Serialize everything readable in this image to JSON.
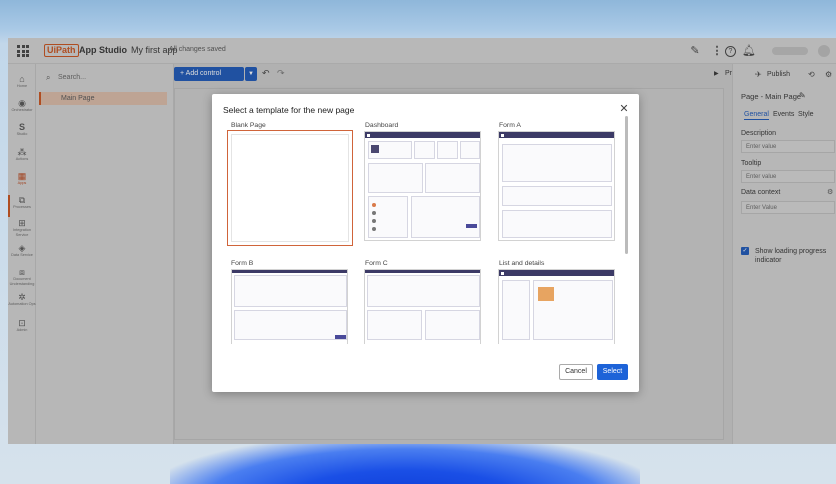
{
  "header": {
    "logo": "UiPath",
    "product": "App Studio",
    "app_name": "My first app",
    "save_status": "All changes saved"
  },
  "left_rail": {
    "items": [
      {
        "icon": "home-icon",
        "label": "Home"
      },
      {
        "icon": "automation-ops-icon",
        "label": "Orchestrator"
      },
      {
        "icon": "studio-icon",
        "label": "Studio"
      },
      {
        "icon": "actions-icon",
        "label": "Actions"
      },
      {
        "icon": "apps-icon",
        "label": "Apps"
      },
      {
        "icon": "processes-icon",
        "label": "Processes"
      },
      {
        "icon": "integration-icon",
        "label": "Integration Service"
      },
      {
        "icon": "data-service-icon",
        "label": "Data Service"
      },
      {
        "icon": "document-understanding-icon",
        "label": "Document Understanding"
      },
      {
        "icon": "automation-ops-icon",
        "label": "Automation Ops"
      },
      {
        "icon": "admin-icon",
        "label": "Admin"
      }
    ]
  },
  "left_panel": {
    "search_placeholder": "Search...",
    "page_item": "Main Page"
  },
  "toolbar": {
    "add_control": "Add control",
    "preview": "Preview",
    "publish": "Publish"
  },
  "right_panel": {
    "title": "Page - Main Page",
    "tabs": [
      "General",
      "Events",
      "Style"
    ],
    "description_label": "Description",
    "description_placeholder": "Enter value",
    "tooltip_label": "Tooltip",
    "tooltip_placeholder": "Enter value",
    "data_context_label": "Data context",
    "data_context_placeholder": "Enter Value",
    "loading_label": "Show loading progress indicator"
  },
  "modal": {
    "title": "Select a template for the new page",
    "templates": [
      {
        "label": "Blank Page"
      },
      {
        "label": "Dashboard"
      },
      {
        "label": "Form A"
      },
      {
        "label": "Form B"
      },
      {
        "label": "Form C"
      },
      {
        "label": "List and details"
      }
    ],
    "cancel": "Cancel",
    "select": "Select"
  },
  "colors": {
    "brand": "#c8511b",
    "primary": "#1d63d8",
    "template_header": "#3c3a66",
    "selected_border": "#d0643a"
  }
}
